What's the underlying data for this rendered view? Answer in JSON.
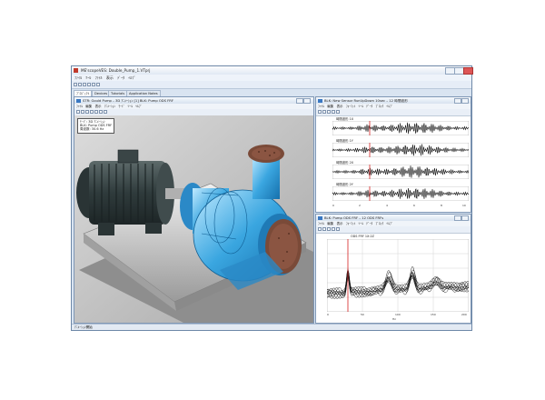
{
  "app": {
    "title": "ME'scopeVES: Double_Pump_1.VTprj",
    "menu": [
      "ﾌｧｲﾙ",
      "ﾂｰﾙ",
      "ﾌｧｲﾙ",
      "表示",
      "ﾃﾞｰﾀ",
      "ﾍﾙﾌﾟ"
    ],
    "tabs": [
      "ﾌﾟﾛｼﾞｪｸﾄ",
      "Devices",
      "Tutorials",
      "Application Notes"
    ],
    "status": "ｱﾆﾒｰｼｮﾝ開始"
  },
  "structure_window": {
    "title": "STR: Gould Pump – 3D ｱﾆﾒｰｼｮﾝ [1] BLK: Pump ODS FRF",
    "menu": [
      "ﾌｧｲﾙ",
      "編集",
      "表示",
      "ｱﾆﾒｰｼｮﾝ",
      "ﾓｰﾄﾞ",
      "ﾂｰﾙ",
      "ﾍﾙﾌﾟ"
    ],
    "info_lines": [
      "ﾓｰﾄﾞ: 3D ｱﾆﾒｰｼｮﾝ",
      "BLK: Pump ODS FRF",
      "周波数: 30.6 Hz"
    ]
  },
  "time_window": {
    "title": "BLK: New Sensor RunUpDown 10sec – 12 時間波形",
    "menu": [
      "ﾌｧｲﾙ",
      "編集",
      "表示",
      "ﾌｫｰﾏｯﾄ",
      "ﾂｰﾙ",
      "ﾃﾞｰﾀ",
      "ﾌﾞﾛｯｸ",
      "ﾍﾙﾌﾟ"
    ],
    "traces": [
      "時間波形 1X",
      "時間波形 1Y",
      "時間波形 2X",
      "時間波形 2Y"
    ],
    "x_ticks": [
      "0",
      "2",
      "4",
      "6",
      "8",
      "10"
    ]
  },
  "frf_window": {
    "title": "BLK: Pump ODS FRF – 12 ODS FRFs",
    "menu": [
      "ﾌｧｲﾙ",
      "編集",
      "表示",
      "ﾌｫｰﾏｯﾄ",
      "ﾂｰﾙ",
      "ﾃﾞｰﾀ",
      "ﾌﾞﾛｯｸ",
      "ﾍﾙﾌﾟ"
    ],
    "trace_label": "ODS FRF 1X:2Z",
    "x_ticks": [
      "0",
      "50",
      "100",
      "150",
      "200"
    ],
    "x_unit": "Hz"
  },
  "colors": {
    "accent": "#3a78c2",
    "marker": "#d62020",
    "trace": "#111111"
  }
}
